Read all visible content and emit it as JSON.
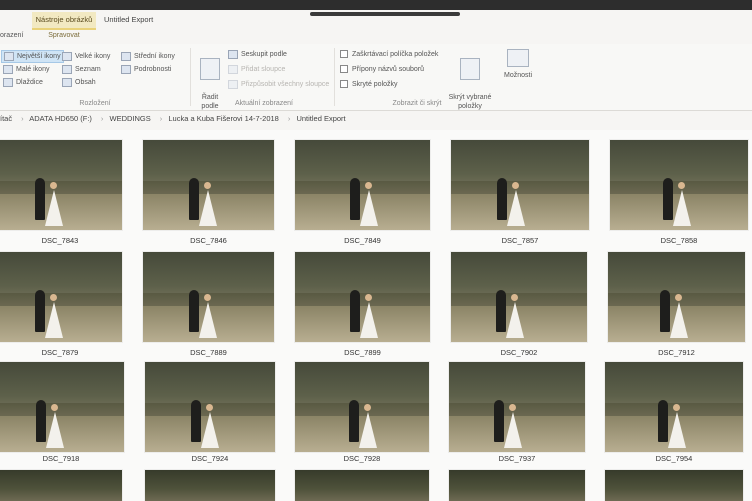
{
  "ribbon": {
    "tabs": {
      "context_tab": "Nástroje obrázků",
      "window_tab": "Untitled Export",
      "left_tab": "orazení",
      "sub_tab": "Spravovat"
    },
    "layout_group": {
      "items": [
        "Největší ikony",
        "Velké ikony",
        "Střední ikony",
        "Malé ikony",
        "Seznam",
        "Podrobnosti",
        "Dlaždice",
        "Obsah"
      ],
      "label": "Rozložení"
    },
    "sort_button": "Řadit\npodle",
    "view_group": {
      "group_by": "Seskupit podle",
      "add_columns": "Přidat sloupce",
      "fit_columns": "Přizpůsobit všechny sloupce",
      "label": "Aktuální zobrazení"
    },
    "show_group": {
      "checkboxes": [
        "Zaškrtávací políčka položek",
        "Přípony názvů souborů",
        "Skryté položky"
      ],
      "hide_selected": "Skrýt vybrané\npoložky",
      "options": "Možnosti",
      "label": "Zobrazit či skrýt"
    }
  },
  "address": {
    "crumbs": [
      "ítač",
      "ADATA HD650 (F:)",
      "WEDDINGS",
      "Lucka a Kuba Fišerovi 14-7-2018",
      "Untitled Export"
    ]
  },
  "files": [
    "DSC_7843",
    "DSC_7846",
    "DSC_7849",
    "DSC_7857",
    "DSC_7858",
    "DSC_7879",
    "DSC_7889",
    "DSC_7899",
    "DSC_7902",
    "DSC_7912",
    "DSC_7918",
    "DSC_7924",
    "DSC_7928",
    "DSC_7937",
    "DSC_7954"
  ],
  "colors": {
    "context_tab_bg": "#f2e9c2",
    "selected_bg": "#cfe4f5"
  }
}
